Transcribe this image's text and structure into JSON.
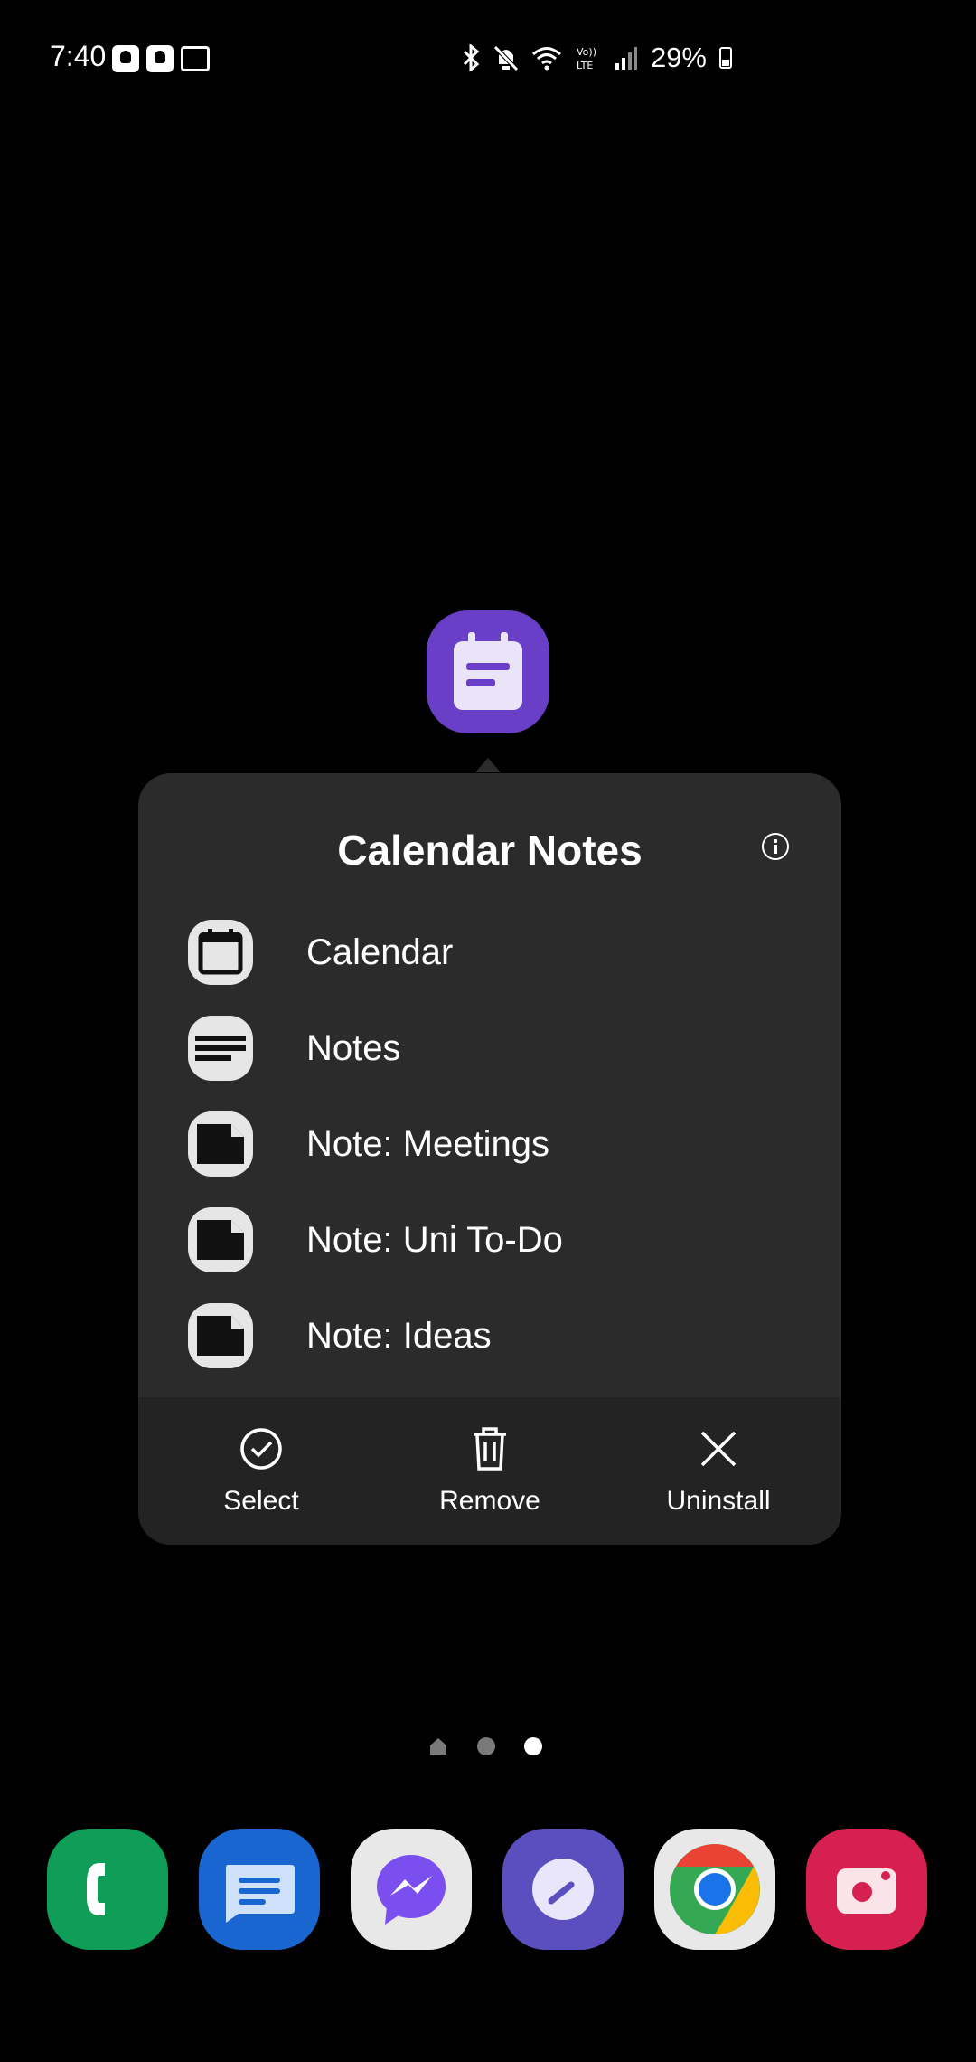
{
  "status_bar": {
    "time": "7:40",
    "battery_percent": "29%",
    "icons": [
      "notification-icon",
      "notification-icon",
      "outlook-icon",
      "bluetooth-icon",
      "mute-icon",
      "wifi-icon",
      "volte-icon",
      "signal-icon",
      "battery-icon"
    ]
  },
  "app": {
    "icon": "calendar-notes-icon",
    "color": "#6a3fc8"
  },
  "popup": {
    "title": "Calendar Notes",
    "info_icon": "info-icon",
    "shortcuts": [
      {
        "label": "Calendar",
        "icon": "calendar-icon"
      },
      {
        "label": "Notes",
        "icon": "notes-icon"
      },
      {
        "label": "Note: Meetings",
        "icon": "note-icon"
      },
      {
        "label": "Note: Uni To-Do",
        "icon": "note-icon"
      },
      {
        "label": "Note: Ideas",
        "icon": "note-icon"
      }
    ],
    "actions": [
      {
        "label": "Select",
        "icon": "check-circle-icon"
      },
      {
        "label": "Remove",
        "icon": "trash-icon"
      },
      {
        "label": "Uninstall",
        "icon": "close-icon"
      }
    ]
  },
  "pager": {
    "pages": 3,
    "current": 3
  },
  "dock": [
    {
      "name": "phone",
      "icon": "phone-icon",
      "color": "#0f9d58"
    },
    {
      "name": "messages",
      "icon": "messages-icon",
      "color": "#1a66d0"
    },
    {
      "name": "messenger",
      "icon": "messenger-icon",
      "color": "#e8e8e8"
    },
    {
      "name": "clock",
      "icon": "clock-icon",
      "color": "#5b4fc0"
    },
    {
      "name": "chrome",
      "icon": "chrome-icon",
      "color": "#e8e8e8"
    },
    {
      "name": "camera",
      "icon": "camera-icon",
      "color": "#d6204f"
    }
  ]
}
